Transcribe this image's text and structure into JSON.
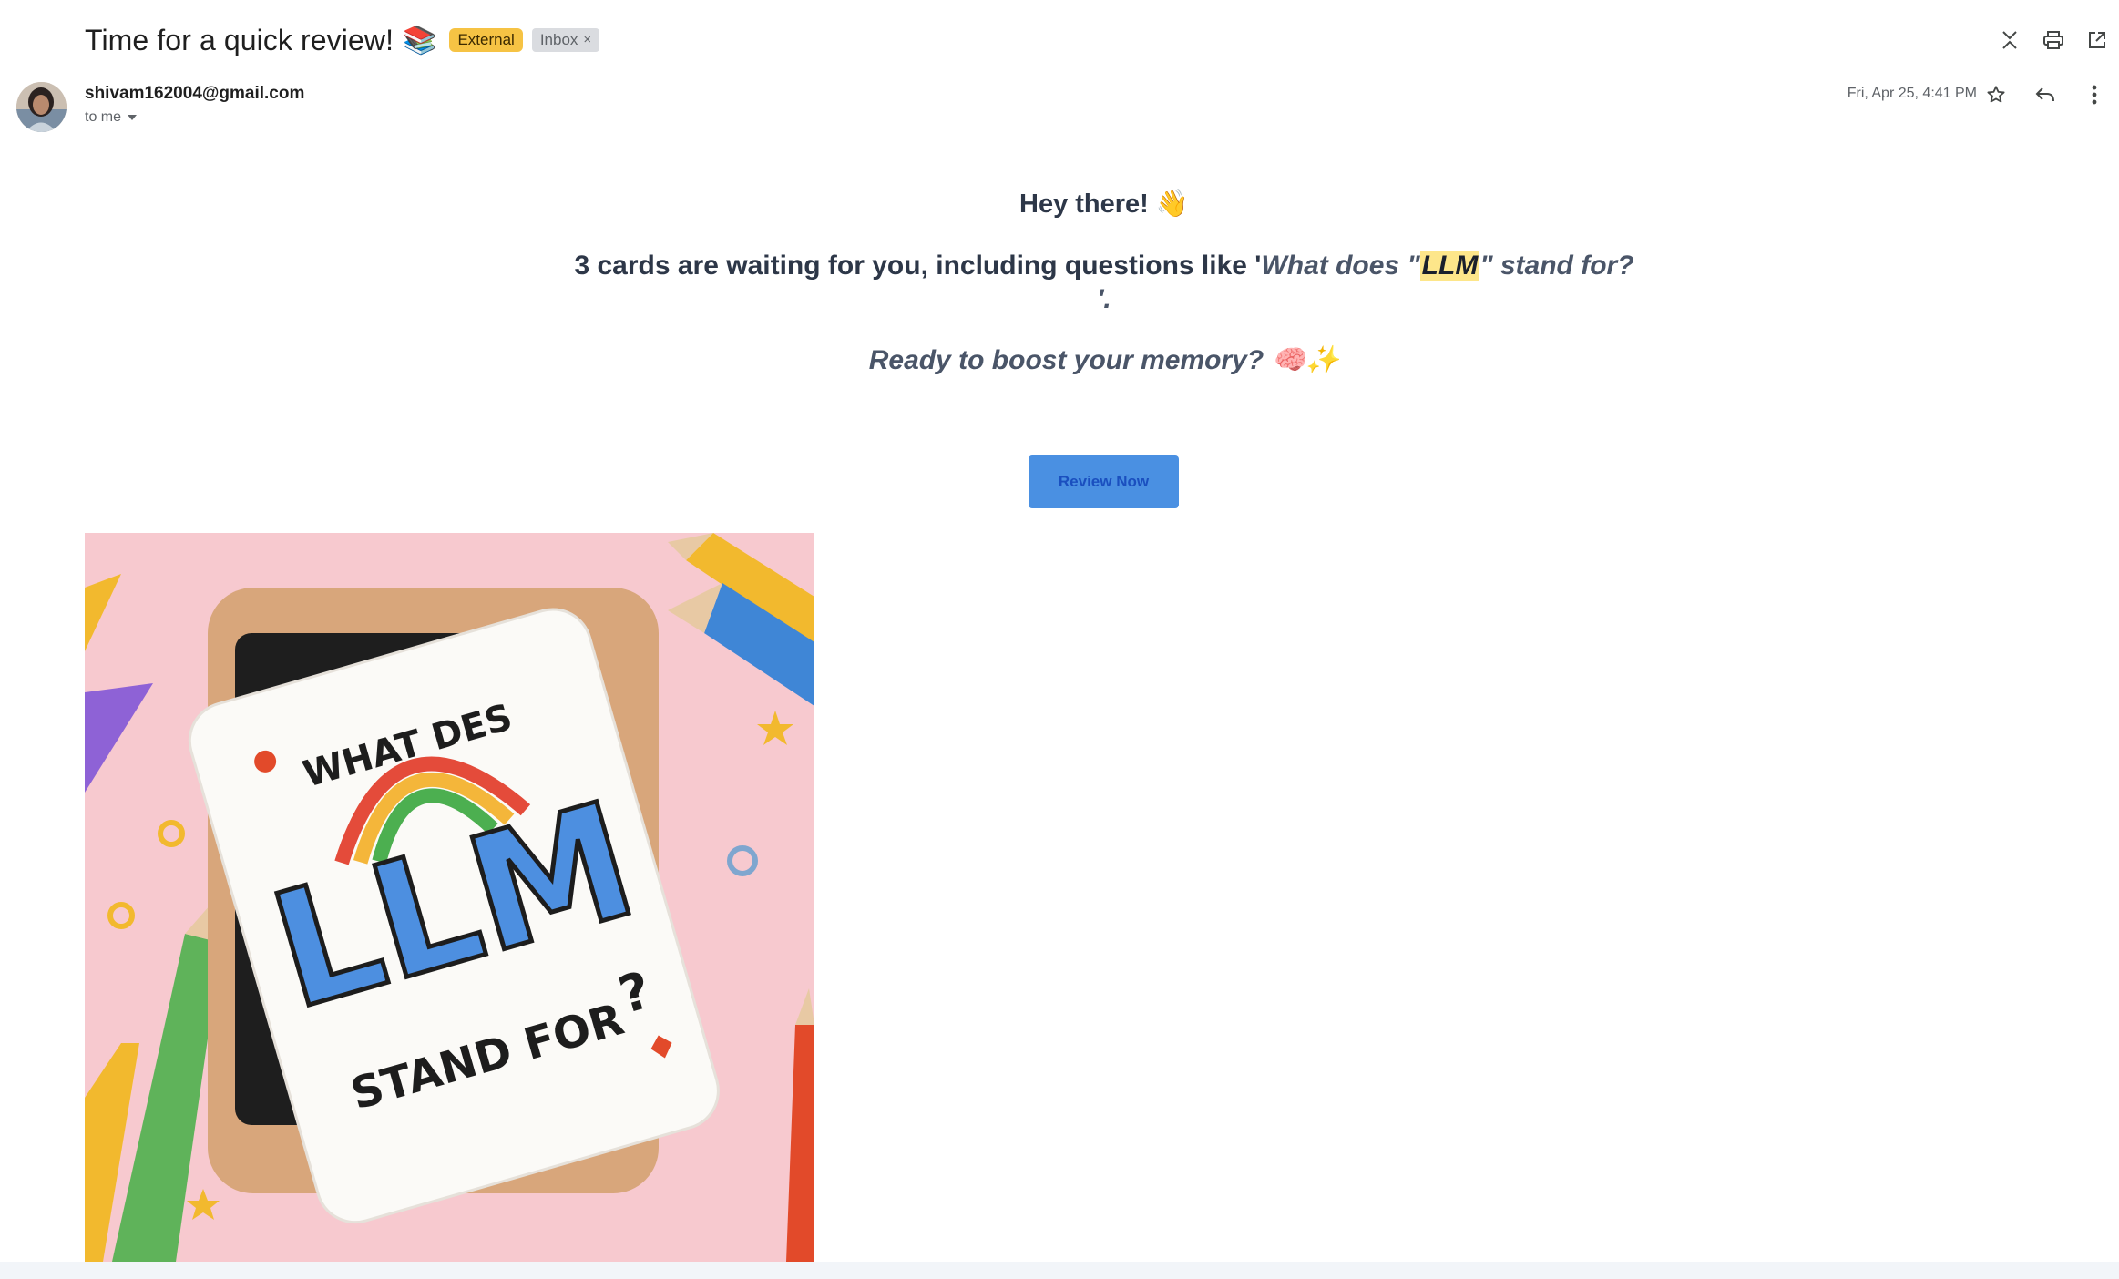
{
  "email": {
    "subject": "Time for a quick review!",
    "subject_emoji": "📚",
    "labels": {
      "external": "External",
      "inbox": "Inbox"
    },
    "sender": "shivam162004@gmail.com",
    "recipient": "to me",
    "date": "Fri, Apr 25, 4:41 PM"
  },
  "body": {
    "greeting": "Hey there! 👋",
    "cards_prefix": "3 cards are waiting for you, including questions like '",
    "question_start": "What does \"",
    "question_highlight": "LLM",
    "question_end": "\" stand for?",
    "cards_suffix": "'.",
    "boost": "Ready to boost your memory? 🧠✨",
    "button_label": "Review Now"
  },
  "illustration": {
    "text_top": "WHAT DES",
    "text_main": "LLM",
    "text_bottom": "STAND FOR",
    "text_question": "?"
  },
  "icons": {
    "collapse": "collapse-icon",
    "print": "print-icon",
    "open_new_window": "open-in-new-window-icon",
    "star": "star-icon",
    "reply": "reply-icon",
    "more": "more-vert-icon",
    "dropdown": "chevron-down-icon"
  },
  "colors": {
    "label_external": "#f6c344",
    "label_inbox": "#dadce0",
    "button": "#4a90e2",
    "highlight": "#fde68a",
    "illustration_background": "#f7c9cf"
  }
}
